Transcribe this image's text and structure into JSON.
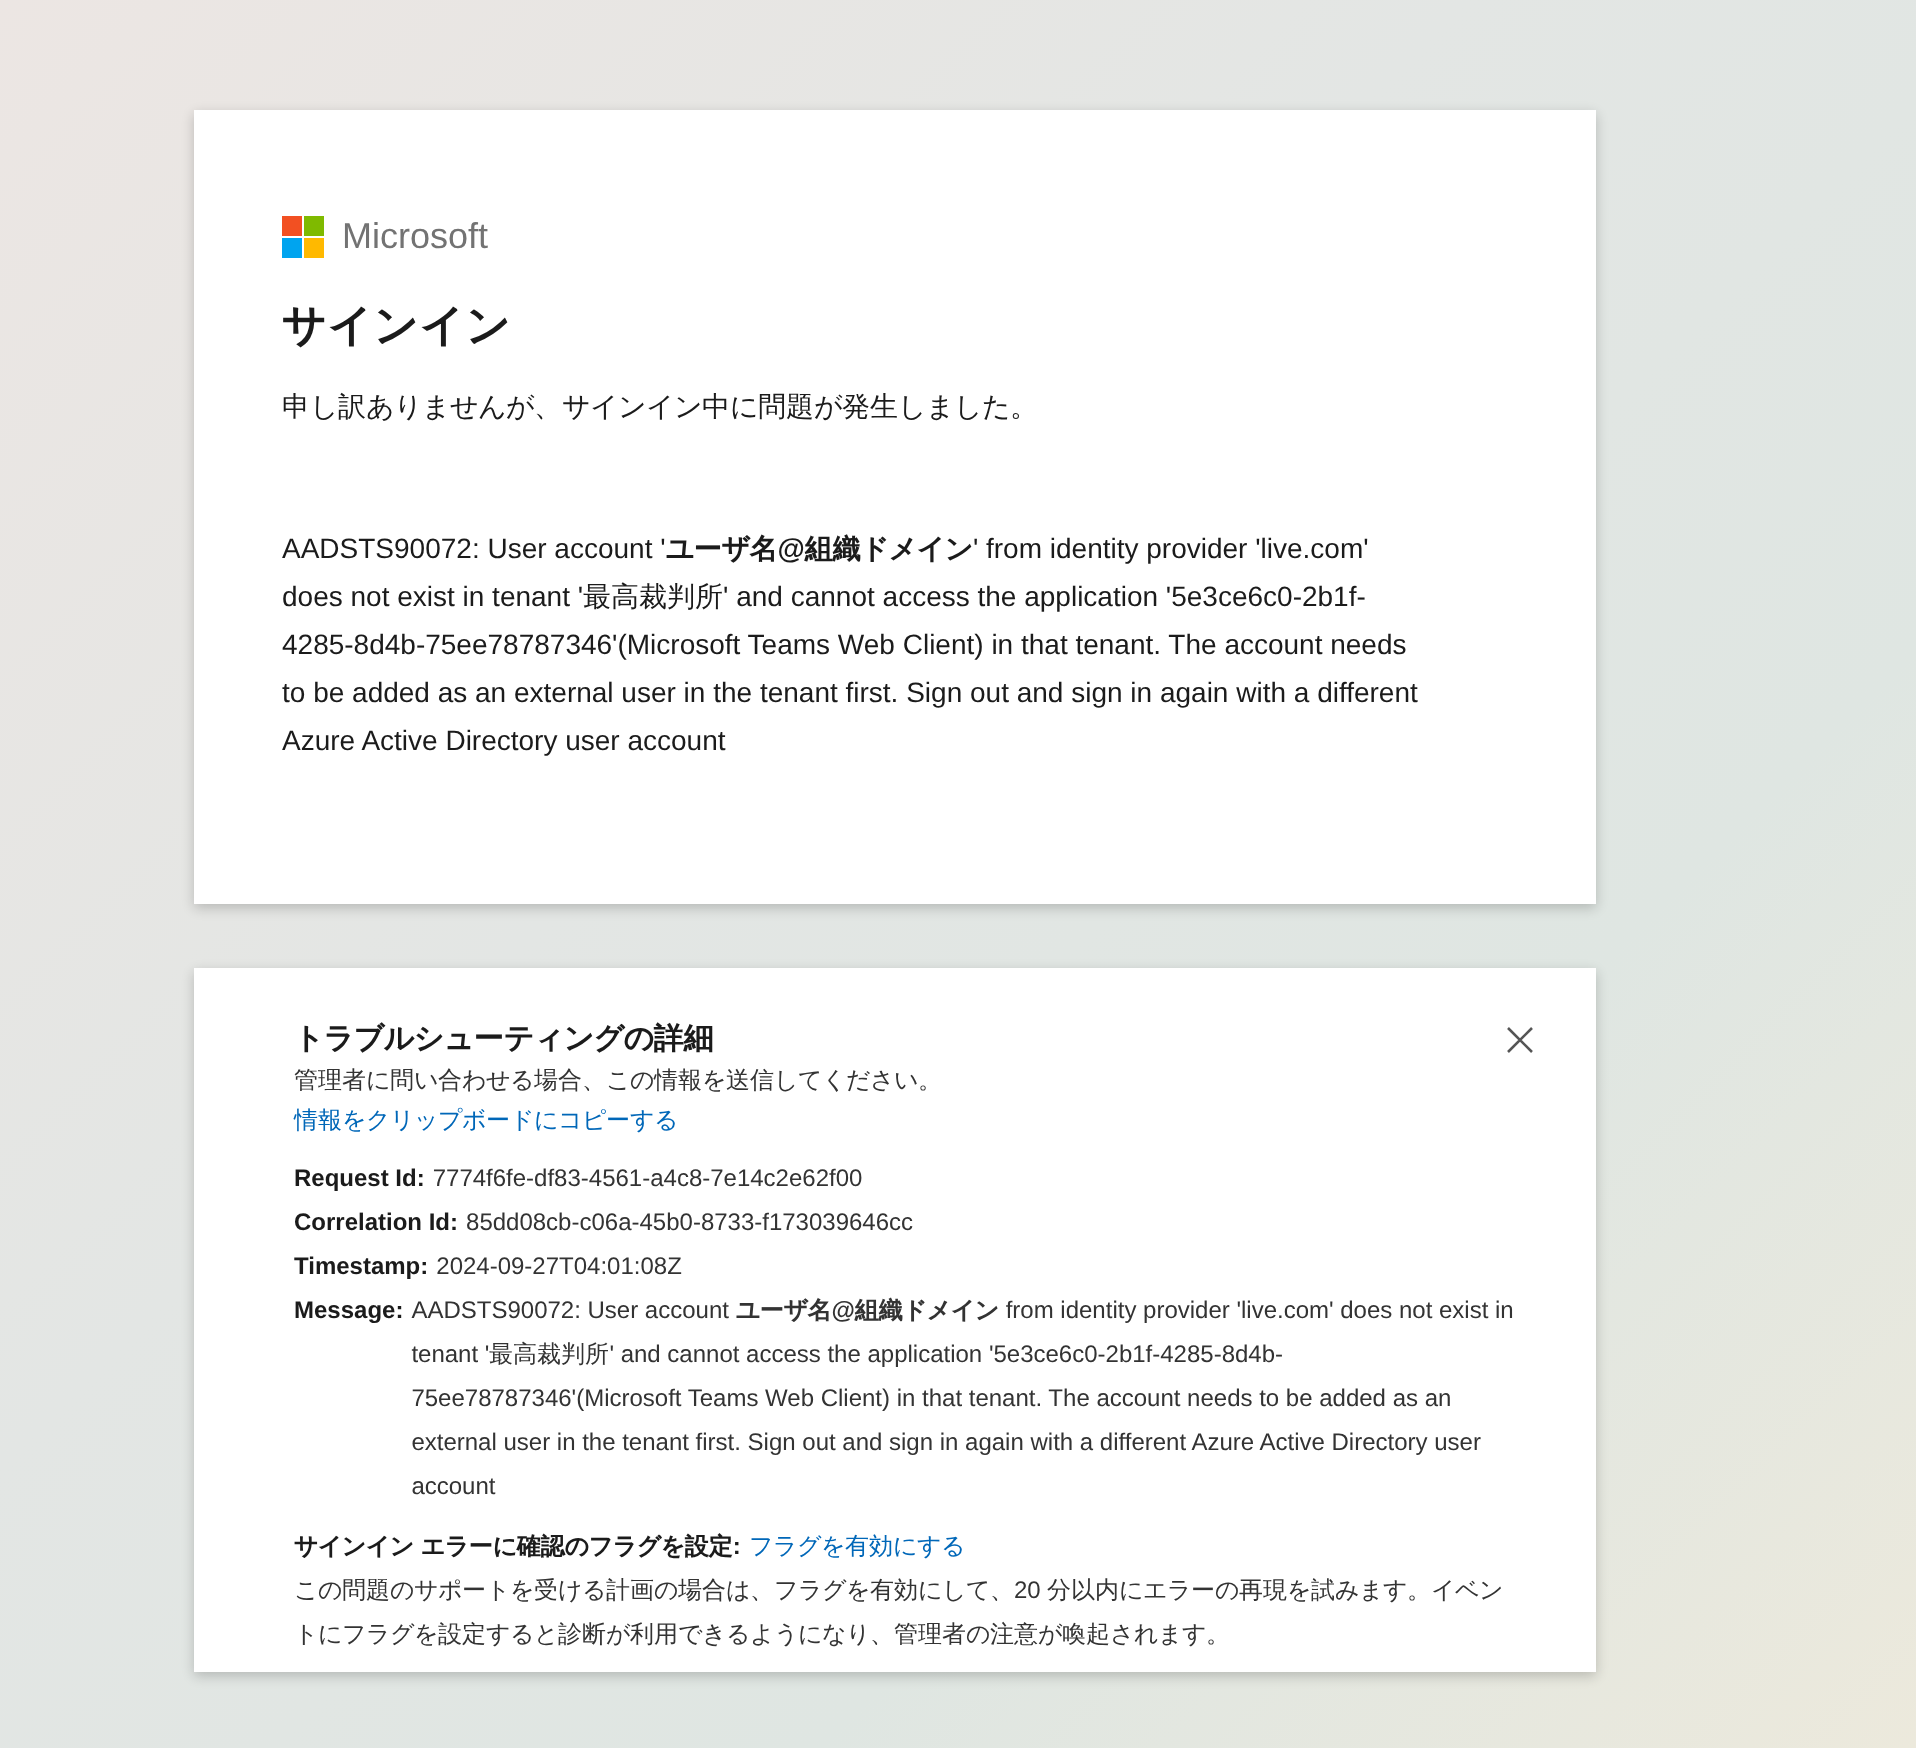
{
  "signin_card": {
    "brand": "Microsoft",
    "title": "サインイン",
    "subtitle": "申し訳ありませんが、サインイン中に問題が発生しました。",
    "error_message": "AADSTS90072: User account '**ユーザ名@組織ドメイン**' from identity provider 'live.com' does not exist in tenant '最高裁判所' and cannot access the application '5e3ce6c0-2b1f-4285-8d4b-75ee78787346'(Microsoft Teams Web Client) in that tenant. The account needs to be added as an external user in the tenant first. Sign out and sign in again with a different Azure Active Directory user account"
  },
  "details_card": {
    "title": "トラブルシューティングの詳細",
    "description": "管理者に問い合わせる場合、この情報を送信してください。",
    "copy_link": "情報をクリップボードにコピーする",
    "fields": [
      {
        "label": "Request Id:",
        "value": "7774f6fe-df83-4561-a4c8-7e14c2e62f00"
      },
      {
        "label": "Correlation Id:",
        "value": "85dd08cb-c06a-45b0-8733-f173039646cc"
      },
      {
        "label": "Timestamp:",
        "value": "2024-09-27T04:01:08Z"
      },
      {
        "label": "Message:",
        "value": "AADSTS90072: User account  **ユーザ名@組織ドメイン**  from identity provider 'live.com' does not exist in tenant '最高裁判所' and cannot access the application '5e3ce6c0-2b1f-4285-8d4b-75ee78787346'(Microsoft Teams Web Client) in that tenant. The account needs to be added as an external user in the tenant first. Sign out and sign in again with a different Azure Active Directory user account"
      }
    ],
    "flag_label": "サインイン エラーに確認のフラグを設定:",
    "flag_link": "フラグを有効にする",
    "flag_description": "この問題のサポートを受ける計画の場合は、フラグを有効にして、20 分以内にエラーの再現を試みます。イベントにフラグを設定すると診断が利用できるようになり、管理者の注意が喚起されます。"
  }
}
